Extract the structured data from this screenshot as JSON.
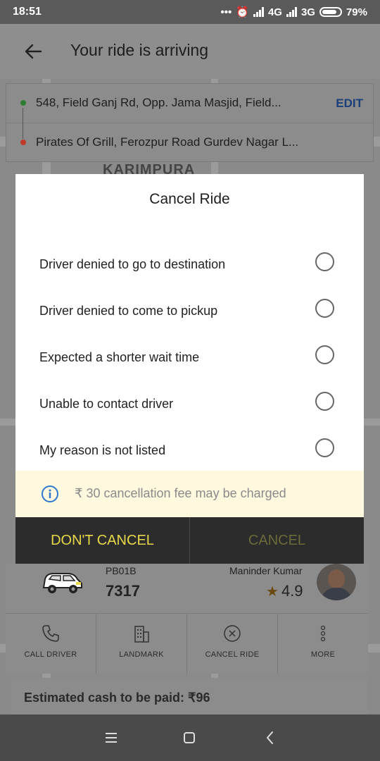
{
  "status_bar": {
    "time": "18:51",
    "network1": "4G",
    "network2": "3G",
    "battery": "79%"
  },
  "app_bar": {
    "title": "Your ride is arriving"
  },
  "route": {
    "pickup": "548, Field Ganj Rd, Opp. Jama Masjid, Field...",
    "drop": "Pirates Of Grill, Ferozpur Road Gurdev Nagar L...",
    "edit_label": "EDIT"
  },
  "map": {
    "area_label": "KARIMPURA"
  },
  "dialog": {
    "title": "Cancel Ride",
    "options": [
      "Driver denied to go to destination",
      "Driver denied to come to pickup",
      "Expected a shorter wait time",
      "Unable to contact driver",
      "My reason is not listed"
    ],
    "fee_notice": "₹ 30 cancellation fee may be charged",
    "dont_cancel_label": "DON'T CANCEL",
    "cancel_label": "CANCEL"
  },
  "driver": {
    "plate_prefix": "PB01B",
    "plate_number": "7317",
    "name": "Maninder Kumar",
    "rating": "4.9"
  },
  "actions": [
    {
      "label": "CALL DRIVER",
      "icon": "phone-icon"
    },
    {
      "label": "LANDMARK",
      "icon": "building-icon"
    },
    {
      "label": "CANCEL RIDE",
      "icon": "cancel-circle-icon"
    },
    {
      "label": "MORE",
      "icon": "more-vertical-icon"
    }
  ],
  "estimate": {
    "text": "Estimated cash to be paid: ₹96"
  },
  "colors": {
    "pickup_dot": "#2e7d32",
    "drop_dot": "#c0392b",
    "accent_yellow": "#e6d84a",
    "info_blue": "#2b78d0"
  }
}
